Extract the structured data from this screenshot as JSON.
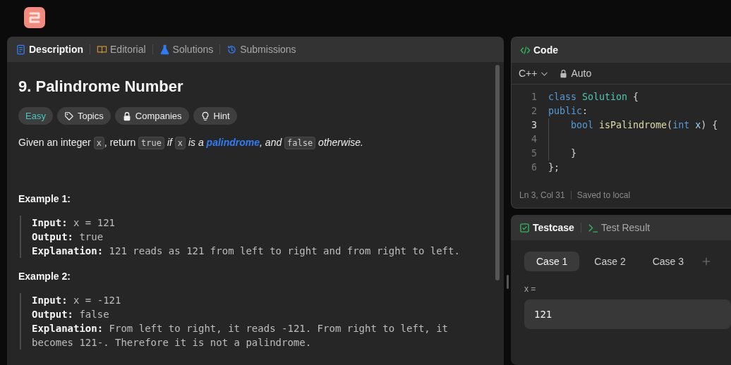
{
  "problem_tabs": [
    {
      "label": "Description",
      "selected": true
    },
    {
      "label": "Editorial",
      "selected": false
    },
    {
      "label": "Solutions",
      "selected": false
    },
    {
      "label": "Submissions",
      "selected": false
    }
  ],
  "problem": {
    "title": "9. Palindrome Number",
    "tags": [
      {
        "label": "Easy",
        "kind": "difficulty"
      },
      {
        "label": "Topics",
        "kind": "tag"
      },
      {
        "label": "Companies",
        "kind": "lock"
      },
      {
        "label": "Hint",
        "kind": "bulb"
      }
    ],
    "statement": [
      {
        "kind": "text",
        "text": "Given an integer "
      },
      {
        "kind": "code",
        "text": "x"
      },
      {
        "kind": "text",
        "text": ", return "
      },
      {
        "kind": "code",
        "text": "true"
      },
      {
        "kind": "italic",
        "text": " if "
      },
      {
        "kind": "code",
        "text": "x"
      },
      {
        "kind": "italic",
        "text": " is a "
      },
      {
        "kind": "link",
        "text": "palindrome"
      },
      {
        "kind": "italic",
        "text": ", and "
      },
      {
        "kind": "code",
        "text": "false"
      },
      {
        "kind": "italic",
        "text": " otherwise."
      }
    ],
    "examples": [
      {
        "title": "Example 1:",
        "lines": [
          {
            "label": "Input:",
            "value": "x = 121"
          },
          {
            "label": "Output:",
            "value": "true"
          },
          {
            "label": "Explanation:",
            "value": "121 reads as 121 from left to right and from right to left."
          }
        ]
      },
      {
        "title": "Example 2:",
        "lines": [
          {
            "label": "Input:",
            "value": "x = -121"
          },
          {
            "label": "Output:",
            "value": "false"
          },
          {
            "label": "Explanation:",
            "value": "From left to right, it reads -121. From right to left, it becomes 121-. Therefore it is not a palindrome."
          }
        ]
      }
    ]
  },
  "code_panel": {
    "title": "Code",
    "language": "C++",
    "mode": "Auto",
    "lines": [
      {
        "number": "1",
        "active": false,
        "indented": false,
        "tokens": [
          {
            "kind": "keyword",
            "text": "class "
          },
          {
            "kind": "type",
            "text": "Solution"
          },
          {
            "kind": "plain",
            "text": " {"
          }
        ]
      },
      {
        "number": "2",
        "active": false,
        "indented": false,
        "tokens": [
          {
            "kind": "keyword",
            "text": "public"
          },
          {
            "kind": "plain",
            "text": ":"
          }
        ]
      },
      {
        "number": "3",
        "active": true,
        "indented": true,
        "tokens": [
          {
            "kind": "keyword",
            "text": "bool "
          },
          {
            "kind": "function",
            "text": "isPalindrome"
          },
          {
            "kind": "plain",
            "text": "("
          },
          {
            "kind": "keyword",
            "text": "int "
          },
          {
            "kind": "param",
            "text": "x"
          },
          {
            "kind": "plain",
            "text": ") {"
          }
        ]
      },
      {
        "number": "4",
        "active": false,
        "indented": true
      },
      {
        "number": "5",
        "active": false,
        "indented": true,
        "tokens": [
          {
            "kind": "plain",
            "text": "}"
          }
        ]
      },
      {
        "number": "6",
        "active": false,
        "indented": false,
        "tokens": [
          {
            "kind": "plain",
            "text": "};"
          }
        ]
      }
    ],
    "status": [
      "Ln 3, Col 31",
      "Saved to local"
    ]
  },
  "test_tabs": [
    {
      "label": "Testcase",
      "selected": true
    },
    {
      "label": "Test Result",
      "selected": false
    }
  ],
  "cases": [
    {
      "label": "Case 1",
      "selected": true
    },
    {
      "label": "Case 2",
      "selected": false
    },
    {
      "label": "Case 3",
      "selected": false
    }
  ],
  "inputs": [
    {
      "label": "x =",
      "value": "121"
    }
  ]
}
